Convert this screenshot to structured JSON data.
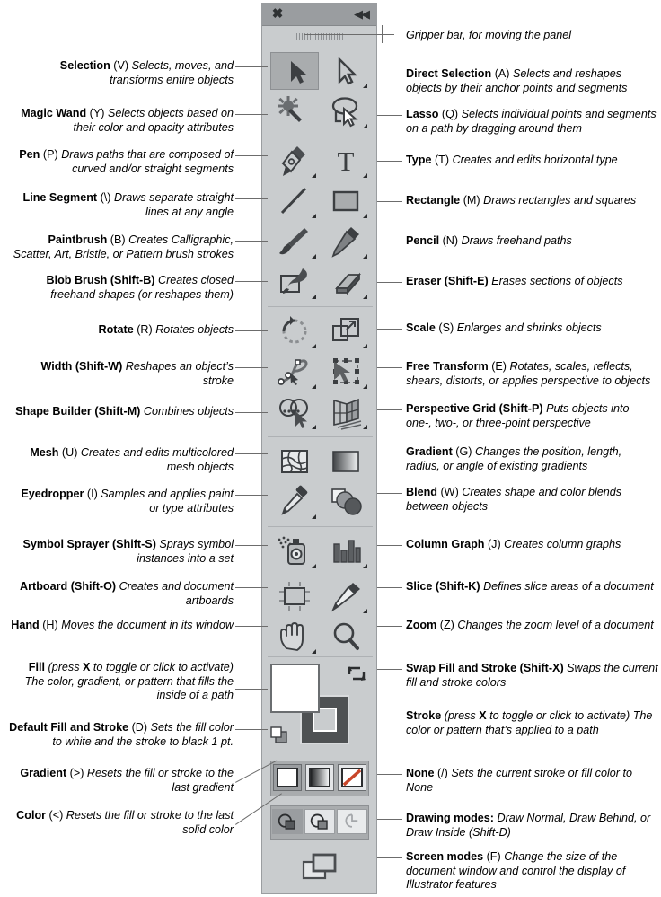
{
  "panel": {
    "title_icons": {
      "close": "✖",
      "collapse": "◀◀"
    },
    "gripper_label": "Gripper bar, for moving the panel"
  },
  "annotations": {
    "gripper": {
      "name": "",
      "key": "",
      "desc": "Gripper bar, for moving the panel"
    },
    "selection": {
      "name": "Selection",
      "key": "(V)",
      "desc": "Selects, moves, and transforms entire objects"
    },
    "direct_selection": {
      "name": "Direct Selection",
      "key": "(A)",
      "desc": "Selects and reshapes objects by their anchor points and segments"
    },
    "magic_wand": {
      "name": "Magic Wand",
      "key": "(Y)",
      "desc": "Selects objects based on their color and opacity attributes"
    },
    "lasso": {
      "name": "Lasso",
      "key": "(Q)",
      "desc": "Selects individual points and segments on a path by dragging around them"
    },
    "pen": {
      "name": "Pen",
      "key": "(P)",
      "desc": "Draws paths that are composed of curved and/or straight segments"
    },
    "type": {
      "name": "Type",
      "key": "(T)",
      "desc": "Creates and edits horizontal type"
    },
    "line_segment": {
      "name": "Line Segment",
      "key": "(\\)",
      "desc": "Draws separate straight lines at any angle"
    },
    "rectangle": {
      "name": "Rectangle",
      "key": "(M)",
      "desc": "Draws rectangles and squares"
    },
    "paintbrush": {
      "name": "Paintbrush",
      "key": "(B)",
      "desc": "Creates Calligraphic, Scatter, Art, Bristle, or Pattern brush strokes"
    },
    "pencil": {
      "name": "Pencil",
      "key": "(N)",
      "desc": "Draws freehand paths"
    },
    "blob_brush": {
      "name": "Blob Brush",
      "key": "(Shift-B)",
      "key_bold": true,
      "desc": "Creates closed freehand shapes (or reshapes them)"
    },
    "eraser": {
      "name": "Eraser",
      "key": "(Shift-E)",
      "key_bold": true,
      "desc": "Erases sections of objects"
    },
    "rotate": {
      "name": "Rotate",
      "key": "(R)",
      "desc": "Rotates objects"
    },
    "scale": {
      "name": "Scale",
      "key": "(S)",
      "desc": "Enlarges and shrinks objects"
    },
    "width": {
      "name": "Width",
      "key": "(Shift-W)",
      "key_bold": true,
      "desc": "Reshapes an object’s stroke"
    },
    "free_transform": {
      "name": "Free Transform",
      "key": "(E)",
      "desc": "Rotates, scales, reflects, shears, distorts, or applies perspective to objects"
    },
    "shape_builder": {
      "name": "Shape Builder",
      "key": "(Shift-M)",
      "key_bold": true,
      "desc": "Combines objects"
    },
    "perspective_grid": {
      "name": "Perspective Grid",
      "key": "(Shift-P)",
      "key_bold": true,
      "desc": "Puts objects into one-, two-, or three-point perspective"
    },
    "mesh": {
      "name": "Mesh",
      "key": "(U)",
      "desc": "Creates and edits multicolored mesh objects"
    },
    "gradient": {
      "name": "Gradient",
      "key": "(G)",
      "desc": "Changes the position, length, radius, or angle of existing gradients"
    },
    "eyedropper": {
      "name": "Eyedropper",
      "key": "(I)",
      "desc": "Samples and applies paint or type attributes"
    },
    "blend": {
      "name": "Blend",
      "key": "(W)",
      "desc": "Creates shape and color blends between objects"
    },
    "symbol_sprayer": {
      "name": "Symbol Sprayer",
      "key": "(Shift-S)",
      "key_bold": true,
      "desc": "Sprays symbol instances into a set"
    },
    "column_graph": {
      "name": "Column Graph",
      "key": "(J)",
      "desc": "Creates column graphs"
    },
    "artboard": {
      "name": "Artboard",
      "key": "(Shift-O)",
      "key_bold": true,
      "desc": "Creates and document artboards"
    },
    "slice": {
      "name": "Slice",
      "key": "(Shift-K)",
      "key_bold": true,
      "desc": "Defines slice areas of a document"
    },
    "hand": {
      "name": "Hand",
      "key": "(H)",
      "desc": "Moves the document in its window"
    },
    "zoom": {
      "name": "Zoom",
      "key": "(Z)",
      "desc": "Changes the zoom level of a document"
    },
    "fill": {
      "name": "Fill",
      "key_italic_pre": "(press ",
      "key_bold_inline": "X",
      "key_italic_post": " to toggle or click to activate)",
      "desc": " The color, gradient, or pattern that fills the inside of a path"
    },
    "swap": {
      "name": "Swap Fill and Stroke",
      "key": "(Shift-X)",
      "key_bold": true,
      "desc": "Swaps the current fill and stroke colors"
    },
    "stroke": {
      "name": "Stroke",
      "key_italic_pre": "(press ",
      "key_bold_inline": "X",
      "key_italic_post": " to toggle or click to activate)",
      "desc": " The color or pattern that’s applied to a path"
    },
    "default_fill": {
      "name": "Default Fill and Stroke",
      "key": "(D)",
      "desc": "Sets the fill color to white and the stroke to black 1 pt."
    },
    "gradient_btn": {
      "name": "Gradient",
      "key": "(>)",
      "desc": "Resets the fill or stroke to the last gradient"
    },
    "color_btn": {
      "name": "Color",
      "key": "(<)",
      "desc": "Resets the fill or stroke to the last solid color"
    },
    "none_btn": {
      "name": "None",
      "key": "(/)",
      "desc": "Sets the current stroke or fill color to None"
    },
    "drawing_modes": {
      "name": "Drawing modes:",
      "key": "",
      "desc": "Draw Normal, Draw Behind, or Draw Inside (Shift-D)"
    },
    "screen_modes": {
      "name": "Screen modes",
      "key": "(F)",
      "desc": "Change the size of the document window and control the display of Illustrator features"
    }
  },
  "colors": {
    "panel_bg": "#c9ccce",
    "titlebar": "#9a9da0",
    "selected_tool": "#a9acae",
    "leader": "#6c6c6c",
    "icon_dark": "#4a4d50",
    "none_red": "#c8462a",
    "fill_white": "#ffffff",
    "stroke_dark": "#4e5153"
  }
}
